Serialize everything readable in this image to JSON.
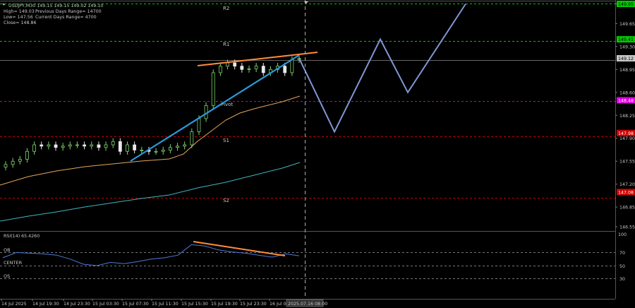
{
  "info": {
    "symbol_line": "USDJPY,M30  149.15 149.15 149.02 149.10",
    "high": "High= 149.03",
    "prev_range": "Previous Days Range= 14700",
    "low": "Low= 147.56",
    "cur_range": "Current Days Range= 4700",
    "close": "Close= 148.86"
  },
  "levels": [
    {
      "name": "R2",
      "label": "R2",
      "price": 149.95,
      "badge": "149.95",
      "color": "#00c800",
      "badge_fg": "#000000"
    },
    {
      "name": "R1",
      "label": "R1",
      "price": 149.41,
      "badge": "149.41",
      "color": "#00c800",
      "badge_fg": "#000000"
    },
    {
      "name": "pivot",
      "label": "Pivot",
      "price": 148.48,
      "badge": "148.48",
      "color": "#e000e0",
      "badge_fg": "#ffffff"
    },
    {
      "name": "S1",
      "label": "S1",
      "price": 147.98,
      "badge": "147.98",
      "color": "#d00000",
      "badge_fg": "#ffffff"
    },
    {
      "name": "S2",
      "label": "S2",
      "price": 147.08,
      "badge": "147.08",
      "color": "#d00000",
      "badge_fg": "#ffffff"
    }
  ],
  "current_price": {
    "price": 149.12,
    "badge": "149.12"
  },
  "price_axis": [
    "149.95",
    "149.65",
    "149.30",
    "148.95",
    "148.60",
    "148.25",
    "147.90",
    "147.55",
    "147.20",
    "146.85",
    "146.55"
  ],
  "rsi": {
    "title": "RSI(14) 65.4260",
    "ticks": [
      "70",
      "50",
      "30"
    ],
    "top_tick": "100",
    "zone_labels": {
      "ob": "OB",
      "center": "CENTER",
      "os": "OS"
    }
  },
  "time_axis": [
    "14 Jul 2025",
    "14 Jul 19:30",
    "14 Jul 23:30",
    "15 Jul 03:30",
    "15 Jul 07:30",
    "15 Jul 11:30",
    "15 Jul 15:30",
    "15 Jul 19:30",
    "15 Jul 23:30",
    "16 Jul 0"
  ],
  "time_cursor_label": "2025.07.16 08:00",
  "chart_data": {
    "type": "candlestick",
    "symbol": "USDJPY",
    "timeframe": "M30",
    "price_ylim": [
      146.55,
      149.95
    ],
    "closes": [
      147.5,
      147.55,
      147.58,
      147.7,
      147.8,
      147.78,
      147.8,
      147.76,
      147.78,
      147.8,
      147.8,
      147.78,
      147.8,
      147.76,
      147.8,
      147.85,
      147.7,
      147.8,
      147.72,
      147.72,
      147.7,
      147.7,
      147.72,
      147.76,
      147.78,
      147.8,
      148.0,
      148.2,
      148.4,
      148.9,
      149.0,
      149.05,
      149.0,
      148.95,
      148.96,
      149.0,
      148.9,
      148.95,
      149.0,
      148.9,
      149.1,
      149.12
    ],
    "future_projection": [
      149.12,
      148.0,
      149.41,
      148.6,
      149.95
    ],
    "rsi_values": [
      62,
      70,
      69,
      68,
      66,
      60,
      52,
      50,
      55,
      53,
      56,
      60,
      62,
      66,
      82,
      80,
      74,
      71,
      69,
      66,
      63,
      68,
      65
    ],
    "rsi_ylim": [
      0,
      100
    ]
  }
}
